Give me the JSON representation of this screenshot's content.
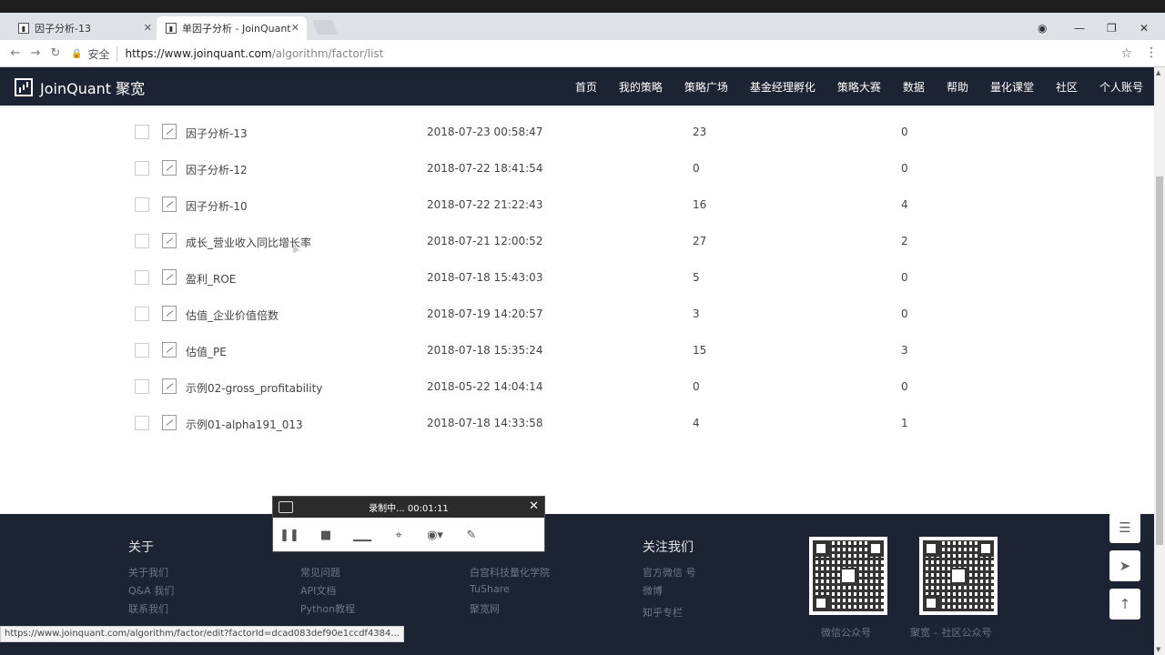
{
  "browser": {
    "tabs": [
      {
        "title": "因子分析-13",
        "active": false
      },
      {
        "title": "单因子分析 - JoinQuant",
        "active": true
      }
    ],
    "address": {
      "secure_label": "安全",
      "url_host": "https://www.joinquant.com",
      "url_path": "/algorithm/factor/list"
    }
  },
  "site": {
    "logo_text": "JoinQuant 聚宽",
    "nav": [
      "首页",
      "我的策略",
      "策略广场",
      "基金经理孵化",
      "策略大赛",
      "数据",
      "帮助",
      "量化课堂",
      "社区",
      "个人账号"
    ]
  },
  "factors": [
    {
      "name": "因子分析-13",
      "time": "2018-07-23 00:58:47",
      "n1": "23",
      "n2": "0"
    },
    {
      "name": "因子分析-12",
      "time": "2018-07-22 18:41:54",
      "n1": "0",
      "n2": "0"
    },
    {
      "name": "因子分析-10",
      "time": "2018-07-22 21:22:43",
      "n1": "16",
      "n2": "4"
    },
    {
      "name": "成长_营业收入同比增长率",
      "time": "2018-07-21 12:00:52",
      "n1": "27",
      "n2": "2"
    },
    {
      "name": "盈利_ROE",
      "time": "2018-07-18 15:43:03",
      "n1": "5",
      "n2": "0"
    },
    {
      "name": "估值_企业价值倍数",
      "time": "2018-07-19 14:20:57",
      "n1": "3",
      "n2": "0"
    },
    {
      "name": "估值_PE",
      "time": "2018-07-18 15:35:24",
      "n1": "15",
      "n2": "3"
    },
    {
      "name": "示例02-gross_profitability",
      "time": "2018-05-22 14:04:14",
      "n1": "0",
      "n2": "0"
    },
    {
      "name": "示例01-alpha191_013",
      "time": "2018-07-18 14:33:58",
      "n1": "4",
      "n2": "1"
    }
  ],
  "footer": {
    "about_title": "关于",
    "about_links": [
      "关于我们",
      "Q&A 我们",
      "联系我们"
    ],
    "col2_links": [
      "常见问题",
      "API文档",
      "Python教程"
    ],
    "col3_links": [
      "白宫科技量化学院",
      "TuShare",
      "聚宽网"
    ],
    "follow_title": "关注我们",
    "follow_links": [
      "官方微信 号",
      "微博",
      "知乎专栏"
    ],
    "qr_captions": [
      "微信公众号",
      "聚宽 – 社区公众号"
    ]
  },
  "recorder": {
    "status": "录制中... 00:01:11"
  },
  "status_link": "https://www.joinquant.com/algorithm/factor/edit?factorId=dcad083def90e1ccdf4384..."
}
